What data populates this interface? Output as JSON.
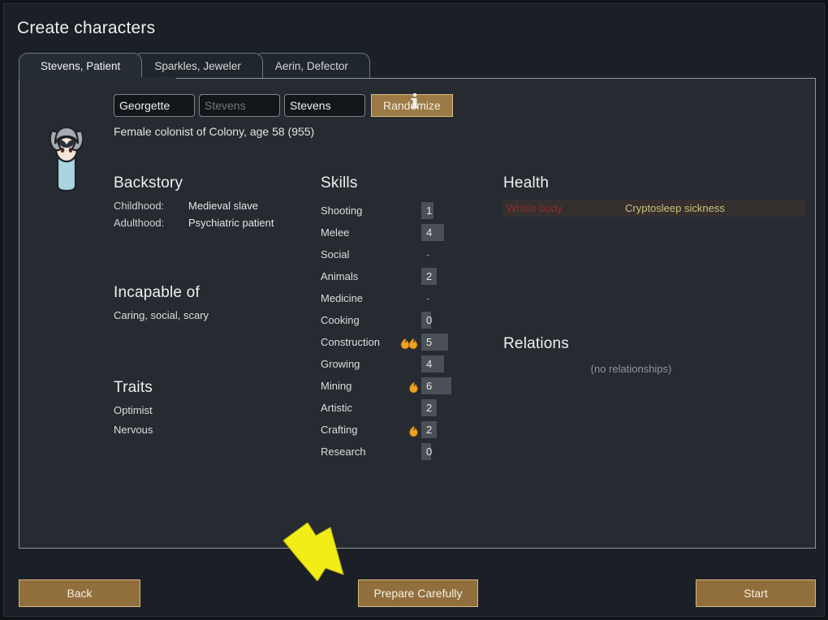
{
  "window": {
    "title": "Create characters"
  },
  "tabs": [
    {
      "label": "Stevens, Patient",
      "active": true
    },
    {
      "label": "Sparkles, Jeweler",
      "active": false
    },
    {
      "label": "Aerin, Defector",
      "active": false
    }
  ],
  "name_row": {
    "first_name": "Georgette",
    "nickname_placeholder": "Stevens",
    "last_name": "Stevens",
    "randomize_label": "Randomize",
    "info_icon": "info-icon"
  },
  "pawn": {
    "subtitle": "Female colonist of Colony, age 58 (955)",
    "portrait_icon": "pawn-portrait"
  },
  "backstory": {
    "title": "Backstory",
    "rows": [
      {
        "label": "Childhood:",
        "value": "Medieval slave"
      },
      {
        "label": "Adulthood:",
        "value": "Psychiatric patient"
      }
    ]
  },
  "incapable": {
    "title": "Incapable of",
    "value": "Caring, social, scary"
  },
  "traits": {
    "title": "Traits",
    "items": [
      "Optimist",
      "Nervous"
    ]
  },
  "skills": {
    "title": "Skills",
    "rows": [
      {
        "name": "Shooting",
        "value": "1",
        "level": 1,
        "passion": "none",
        "disabled": false
      },
      {
        "name": "Melee",
        "value": "4",
        "level": 4,
        "passion": "none",
        "disabled": false
      },
      {
        "name": "Social",
        "value": "-",
        "level": 0,
        "passion": "none",
        "disabled": true
      },
      {
        "name": "Animals",
        "value": "2",
        "level": 2,
        "passion": "none",
        "disabled": false
      },
      {
        "name": "Medicine",
        "value": "-",
        "level": 0,
        "passion": "none",
        "disabled": true
      },
      {
        "name": "Cooking",
        "value": "0",
        "level": 0,
        "passion": "none",
        "disabled": false
      },
      {
        "name": "Construction",
        "value": "5",
        "level": 5,
        "passion": "major",
        "disabled": false
      },
      {
        "name": "Growing",
        "value": "4",
        "level": 4,
        "passion": "none",
        "disabled": false
      },
      {
        "name": "Mining",
        "value": "6",
        "level": 6,
        "passion": "minor",
        "disabled": false
      },
      {
        "name": "Artistic",
        "value": "2",
        "level": 2,
        "passion": "none",
        "disabled": false
      },
      {
        "name": "Crafting",
        "value": "2",
        "level": 2,
        "passion": "minor",
        "disabled": false
      },
      {
        "name": "Research",
        "value": "0",
        "level": 0,
        "passion": "none",
        "disabled": false
      }
    ]
  },
  "health": {
    "title": "Health",
    "rows": [
      {
        "part": "Whole body",
        "condition": "Cryptosleep sickness"
      }
    ]
  },
  "relations": {
    "title": "Relations",
    "empty_text": "(no relationships)"
  },
  "bottom_bar": {
    "back_label": "Back",
    "prepare_label": "Prepare Carefully",
    "start_label": "Start"
  },
  "annotation": {
    "arrow_icon": "arrow-down-right-icon",
    "arrow_color": "#f2ed16",
    "points_to": "Prepare Carefully"
  },
  "colors": {
    "accent_button": "#916f3d",
    "accent_border": "#d5b683",
    "panel_bg": "#262b31",
    "window_bg": "#1b2026",
    "skill_bar": "#4b5057",
    "health_condition": "#c9c07a",
    "health_part": "#8c2b2b"
  }
}
